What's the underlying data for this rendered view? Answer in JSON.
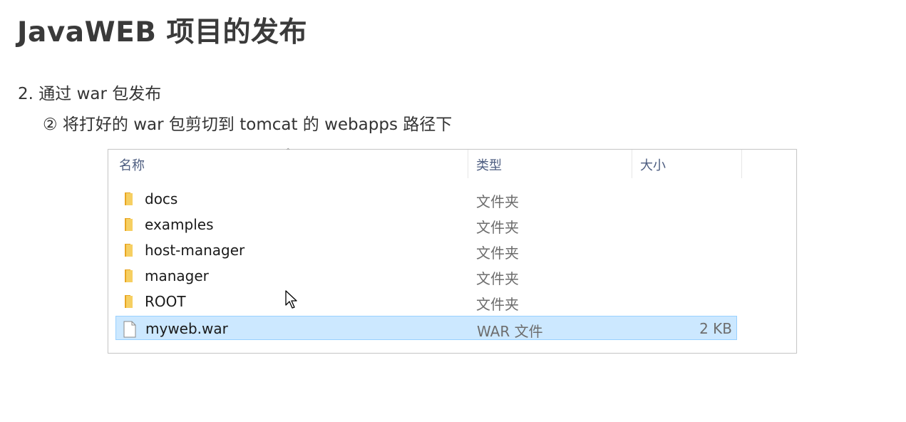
{
  "slide": {
    "title": "JavaWEB 项目的发布",
    "line1": "2. 通过 war 包发布",
    "line2": "② 将打好的 war 包剪切到 tomcat 的 webapps 路径下"
  },
  "explorer": {
    "columns": {
      "name": "名称",
      "type": "类型",
      "size": "大小"
    },
    "rows": [
      {
        "name": "docs",
        "type": "文件夹",
        "size": "",
        "icon": "folder-icon"
      },
      {
        "name": "examples",
        "type": "文件夹",
        "size": "",
        "icon": "folder-icon"
      },
      {
        "name": "host-manager",
        "type": "文件夹",
        "size": "",
        "icon": "folder-icon"
      },
      {
        "name": "manager",
        "type": "文件夹",
        "size": "",
        "icon": "folder-icon"
      },
      {
        "name": "ROOT",
        "type": "文件夹",
        "size": "",
        "icon": "folder-icon"
      },
      {
        "name": "myweb.war",
        "type": "WAR 文件",
        "size": "2 KB",
        "icon": "file-icon",
        "selected": true
      }
    ]
  },
  "colors": {
    "selection_bg": "#cce8ff",
    "selection_border": "#99d1ff",
    "folder": "#f0c14d",
    "header_text": "#4d5d80"
  }
}
